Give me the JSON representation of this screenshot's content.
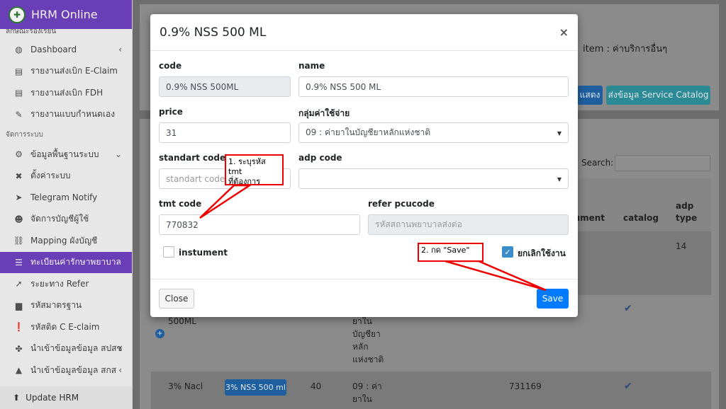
{
  "app": {
    "title": "HRM Online"
  },
  "sidebar": {
    "cut_header": "ลักษณะร้องเรียน",
    "items": [
      {
        "label": "Dashboard",
        "icon": "dashboard-icon",
        "has_chevron": true
      },
      {
        "label": "รายงานส่งเบิก E-Claim",
        "icon": "report-icon"
      },
      {
        "label": "รายงานส่งเบิก FDH",
        "icon": "report-icon"
      },
      {
        "label": "รายงานแบบกำหนดเอง",
        "icon": "custom-report-icon"
      }
    ],
    "section_label": "จัดการระบบ",
    "system_items": [
      {
        "label": "ข้อมูลพื้นฐานระบบ",
        "icon": "users-gear-icon",
        "has_chevron": true
      },
      {
        "label": "ตั้งค่าระบบ",
        "icon": "tools-icon"
      },
      {
        "label": "Telegram Notify",
        "icon": "telegram-icon"
      },
      {
        "label": "จัดการบัญชีผู้ใช้",
        "icon": "users-icon"
      },
      {
        "label": "Mapping ผังบัญชี",
        "icon": "mapping-icon"
      },
      {
        "label": "ทะเบียนค่ารักษาพยาบาล",
        "icon": "list-icon",
        "active": true
      },
      {
        "label": "ระยะทาง Refer",
        "icon": "location-arrow-icon"
      },
      {
        "label": "รหัสมาตรฐาน",
        "icon": "file-code-icon"
      },
      {
        "label": "รหัสติด C E-claim",
        "icon": "exclamation-icon"
      },
      {
        "label": "นำเข้าข้อมูลข้อมูล สปสช",
        "icon": "puzzle-icon",
        "has_chevron": true
      },
      {
        "label": "นำเข้าข้อมูลข้อมูล สกส",
        "icon": "triangle-icon",
        "has_chevron": true
      }
    ],
    "footer_label": "Update HRM"
  },
  "background": {
    "item_text": "item : ค่าบริการอื่นๆ",
    "btn_show": "แสดง",
    "btn_service_catalog": "ส่งข้อมูล Service Catalog",
    "search_label": "Search:",
    "col_instument": "ıment",
    "col_catalog": "catalog",
    "col_adp_type_line1": "adp",
    "col_adp_type_line2": "type",
    "row1_adp_type": "14",
    "row2_name": "500ML",
    "row2_group": [
      "ยาใน",
      "บัญชียา",
      "หลัก",
      "แห่งชาติ"
    ],
    "row3_code": "3% Nacl",
    "row3_name_badge": "3% NSS 500 ml",
    "row3_price": "40",
    "row3_group": [
      "09 : ค่า",
      "ยาใน"
    ],
    "row3_tmt": "731169"
  },
  "modal": {
    "title": "0.9% NSS 500 ML",
    "code_label": "code",
    "code_value": "0.9% NSS 500ML",
    "name_label": "name",
    "name_value": "0.9% NSS 500 ML",
    "price_label": "price",
    "price_value": "31",
    "group_label": "กลุ่มค่าใช้จ่าย",
    "group_value": "09 : ค่ายาในบัญชียาหลักแห่งชาติ",
    "standard_code_label": "standart code",
    "standard_code_placeholder": "standart code",
    "adp_code_label": "adp code",
    "adp_code_value": "",
    "tmt_code_label": "tmt code",
    "tmt_code_value": "770832",
    "refer_pcucode_label": "refer pcucode",
    "refer_pcucode_placeholder": "รหัสสถานพยาบาลส่งต่อ",
    "instument_label": "instument",
    "instument_checked": false,
    "cancel_use_label": "ยกเลิกใช้งาน",
    "cancel_use_checked": true,
    "close_button": "Close",
    "save_button": "Save"
  },
  "annotations": {
    "note1_line1": "1. ระบุรหัส tmt",
    "note1_line2": "ที่ต้องการ",
    "note2": "2. กด \"Save\""
  },
  "colors": {
    "brand": "#6f42c1",
    "save": "#007bff",
    "annotation": "#e00000",
    "checkbox": "#3b8dc9"
  }
}
